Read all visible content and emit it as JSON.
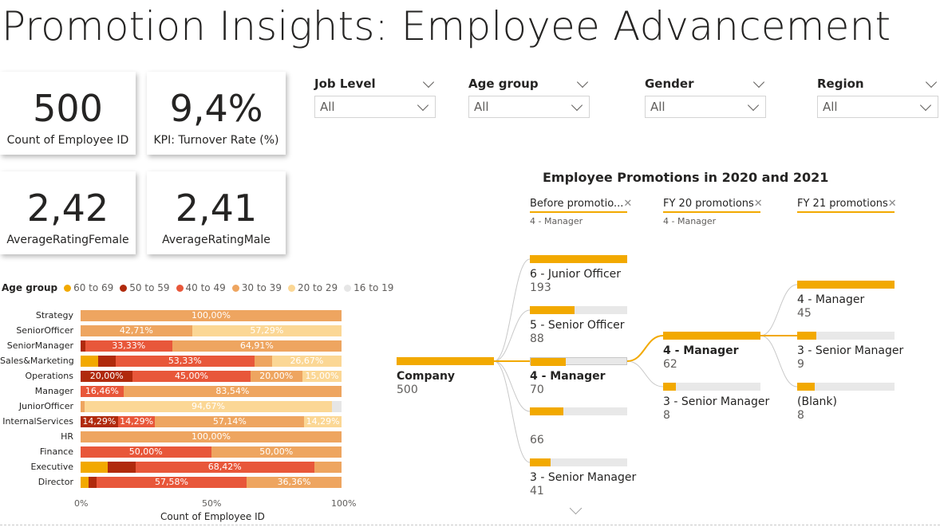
{
  "page_title": "Promotion Insights: Employee Advancement",
  "kpis": {
    "count": {
      "value": "500",
      "label": "Count of Employee ID"
    },
    "turnover": {
      "value": "9,4%",
      "label": "KPI: Turnover Rate (%)"
    },
    "rating_female": {
      "value": "2,42",
      "label": "AverageRatingFemale"
    },
    "rating_male": {
      "value": "2,41",
      "label": "AverageRatingMale"
    }
  },
  "slicers": [
    {
      "title": "Job Level",
      "value": "All"
    },
    {
      "title": "Age group",
      "value": "All"
    },
    {
      "title": "Gender",
      "value": "All"
    },
    {
      "title": "Region",
      "value": "All"
    }
  ],
  "colors": {
    "60 to 69": "#f2a900",
    "50 to 59": "#b02a0c",
    "40 to 49": "#e8573a",
    "30 to 39": "#eea560",
    "20 to 29": "#fbd795",
    "16 to 19": "#e6e6e6",
    "accent": "#f2a900"
  },
  "chart_data": {
    "type": "bar",
    "orientation": "horizontal-100%-stacked",
    "legend_title": "Age group",
    "legend_position": "top-left",
    "series_order": [
      "60 to 69",
      "50 to 59",
      "40 to 49",
      "30 to 39",
      "20 to 29",
      "16 to 19"
    ],
    "categories": [
      "Strategy",
      "SeniorOfficer",
      "SeniorManager",
      "Sales&Marketing",
      "Operations",
      "Manager",
      "JuniorOfficer",
      "InternalServices",
      "HR",
      "Finance",
      "Executive",
      "Director"
    ],
    "rows": [
      {
        "category": "Strategy",
        "segments": [
          {
            "series": "30 to 39",
            "value": 100.0,
            "label": "100,00%"
          }
        ]
      },
      {
        "category": "SeniorOfficer",
        "segments": [
          {
            "series": "30 to 39",
            "value": 42.71,
            "label": "42,71%"
          },
          {
            "series": "20 to 29",
            "value": 57.29,
            "label": "57,29%"
          }
        ]
      },
      {
        "category": "SeniorManager",
        "segments": [
          {
            "series": "50 to 59",
            "value": 1.76,
            "label": ""
          },
          {
            "series": "40 to 49",
            "value": 33.33,
            "label": "33,33%"
          },
          {
            "series": "30 to 39",
            "value": 64.91,
            "label": "64,91%"
          }
        ]
      },
      {
        "category": "Sales&Marketing",
        "segments": [
          {
            "series": "60 to 69",
            "value": 6.67,
            "label": ""
          },
          {
            "series": "50 to 59",
            "value": 6.67,
            "label": ""
          },
          {
            "series": "40 to 49",
            "value": 53.33,
            "label": "53,33%"
          },
          {
            "series": "30 to 39",
            "value": 6.67,
            "label": ""
          },
          {
            "series": "20 to 29",
            "value": 26.67,
            "label": "26,67%"
          }
        ]
      },
      {
        "category": "Operations",
        "segments": [
          {
            "series": "50 to 59",
            "value": 20.0,
            "label": "20,00%"
          },
          {
            "series": "40 to 49",
            "value": 45.0,
            "label": "45,00%"
          },
          {
            "series": "30 to 39",
            "value": 20.0,
            "label": "20,00%"
          },
          {
            "series": "20 to 29",
            "value": 15.0,
            "label": "15,00%"
          }
        ]
      },
      {
        "category": "Manager",
        "segments": [
          {
            "series": "40 to 49",
            "value": 16.46,
            "label": "16,46%"
          },
          {
            "series": "30 to 39",
            "value": 83.54,
            "label": "83,54%"
          }
        ]
      },
      {
        "category": "JuniorOfficer",
        "segments": [
          {
            "series": "30 to 39",
            "value": 1.6,
            "label": ""
          },
          {
            "series": "20 to 29",
            "value": 94.67,
            "label": "94,67%"
          },
          {
            "series": "16 to 19",
            "value": 3.73,
            "label": ""
          }
        ]
      },
      {
        "category": "InternalServices",
        "segments": [
          {
            "series": "50 to 59",
            "value": 14.29,
            "label": "14,29%"
          },
          {
            "series": "40 to 49",
            "value": 14.29,
            "label": "14,29%"
          },
          {
            "series": "30 to 39",
            "value": 57.14,
            "label": "57,14%"
          },
          {
            "series": "20 to 29",
            "value": 14.29,
            "label": "14,29%"
          }
        ]
      },
      {
        "category": "HR",
        "segments": [
          {
            "series": "30 to 39",
            "value": 100.0,
            "label": "100,00%"
          }
        ]
      },
      {
        "category": "Finance",
        "segments": [
          {
            "series": "40 to 49",
            "value": 50.0,
            "label": "50,00%"
          },
          {
            "series": "30 to 39",
            "value": 50.0,
            "label": "50,00%"
          }
        ]
      },
      {
        "category": "Executive",
        "segments": [
          {
            "series": "60 to 69",
            "value": 10.53,
            "label": ""
          },
          {
            "series": "50 to 59",
            "value": 10.53,
            "label": ""
          },
          {
            "series": "40 to 49",
            "value": 68.42,
            "label": "68,42%"
          },
          {
            "series": "30 to 39",
            "value": 10.52,
            "label": ""
          }
        ]
      },
      {
        "category": "Director",
        "segments": [
          {
            "series": "60 to 69",
            "value": 3.03,
            "label": ""
          },
          {
            "series": "50 to 59",
            "value": 3.03,
            "label": ""
          },
          {
            "series": "40 to 49",
            "value": 57.58,
            "label": "57,58%"
          },
          {
            "series": "30 to 39",
            "value": 36.36,
            "label": "36,36%"
          }
        ]
      }
    ],
    "x_ticks": [
      "0%",
      "50%",
      "100%"
    ],
    "xlim": [
      0,
      100
    ],
    "xlabel": "Count of Employee ID",
    "ylabel": ""
  },
  "tree": {
    "title": "Employee Promotions in 2020 and 2021",
    "levels": [
      {
        "header": "Before promotio...",
        "sub": "4 - Manager"
      },
      {
        "header": "FY 20 promotions",
        "sub": "4 - Manager"
      },
      {
        "header": "FY 21 promotions",
        "sub": ""
      }
    ],
    "root": {
      "label": "Company",
      "value": "500",
      "fill": 1.0
    },
    "col1": [
      {
        "label": "6 - Junior Officer",
        "value": "193",
        "fill": 1.0,
        "bold": false
      },
      {
        "label": "5 - Senior Officer",
        "value": "88",
        "fill": 0.456,
        "bold": false
      },
      {
        "label": "4 - Manager",
        "value": "70",
        "fill": 0.363,
        "bold": true
      },
      {
        "label": "",
        "value": "66",
        "fill": 0.342,
        "bold": false
      },
      {
        "label": "3 - Senior Manager",
        "value": "41",
        "fill": 0.212,
        "bold": false
      }
    ],
    "col2": [
      {
        "label": "4 - Manager",
        "value": "62",
        "fill": 1.0,
        "bold": true
      },
      {
        "label": "3 - Senior Manager",
        "value": "8",
        "fill": 0.129,
        "bold": false
      }
    ],
    "col3": [
      {
        "label": "4 - Manager",
        "value": "45",
        "fill": 1.0,
        "bold": false
      },
      {
        "label": "3 - Senior Manager",
        "value": "9",
        "fill": 0.2,
        "bold": false
      },
      {
        "label": "(Blank)",
        "value": "8",
        "fill": 0.178,
        "bold": false
      }
    ]
  }
}
